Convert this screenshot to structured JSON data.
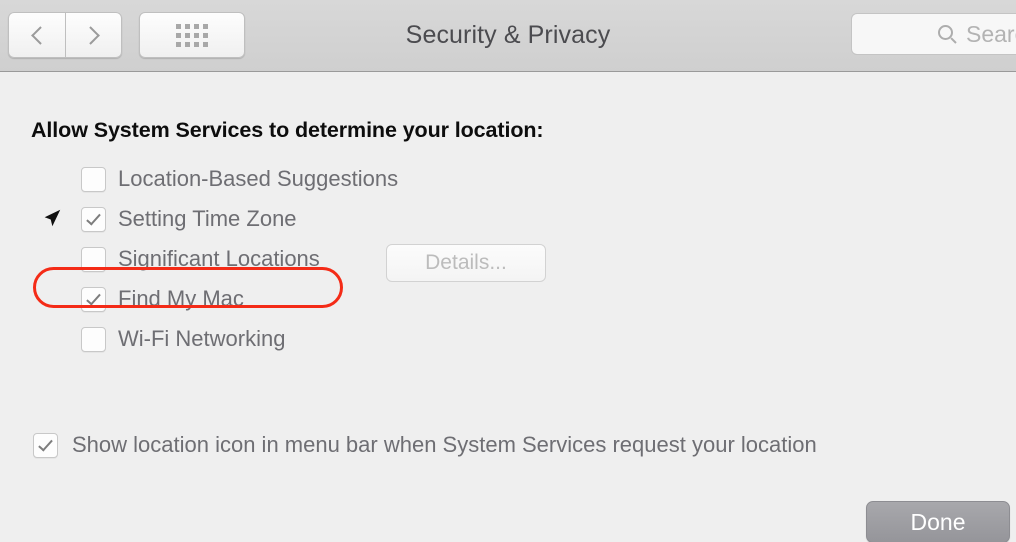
{
  "window": {
    "title": "Security & Privacy"
  },
  "toolbar": {
    "back_icon": "chevron-left-icon",
    "forward_icon": "chevron-right-icon",
    "grid_icon": "grid-view-icon",
    "search": {
      "icon": "search-icon",
      "placeholder": "Search",
      "visible_text": "Sea",
      "value": ""
    }
  },
  "main": {
    "heading": "Allow System Services to determine your location:",
    "services": [
      {
        "label": "Location-Based Suggestions",
        "checked": false
      },
      {
        "label": "Setting Time Zone",
        "checked": true,
        "icon": "location-arrow-icon",
        "highlighted": true
      },
      {
        "label": "Significant Locations",
        "checked": false,
        "button": "Details..."
      },
      {
        "label": "Find My Mac",
        "checked": true
      },
      {
        "label": "Wi-Fi Networking",
        "checked": false
      }
    ],
    "details_button_label": "Details...",
    "show_location_icon": {
      "label": "Show location icon in menu bar when System Services request your location",
      "checked": true
    },
    "done_button_label": "Done"
  },
  "colors": {
    "toolbar_bg": "#d2d2d2",
    "content_bg": "#efefef",
    "label_text": "#6e6e73",
    "heading_text": "#0d0d0d",
    "highlight_ring": "#f42b17",
    "done_button_bg": "#9d9da2",
    "disabled_text": "#bcbcbc"
  }
}
